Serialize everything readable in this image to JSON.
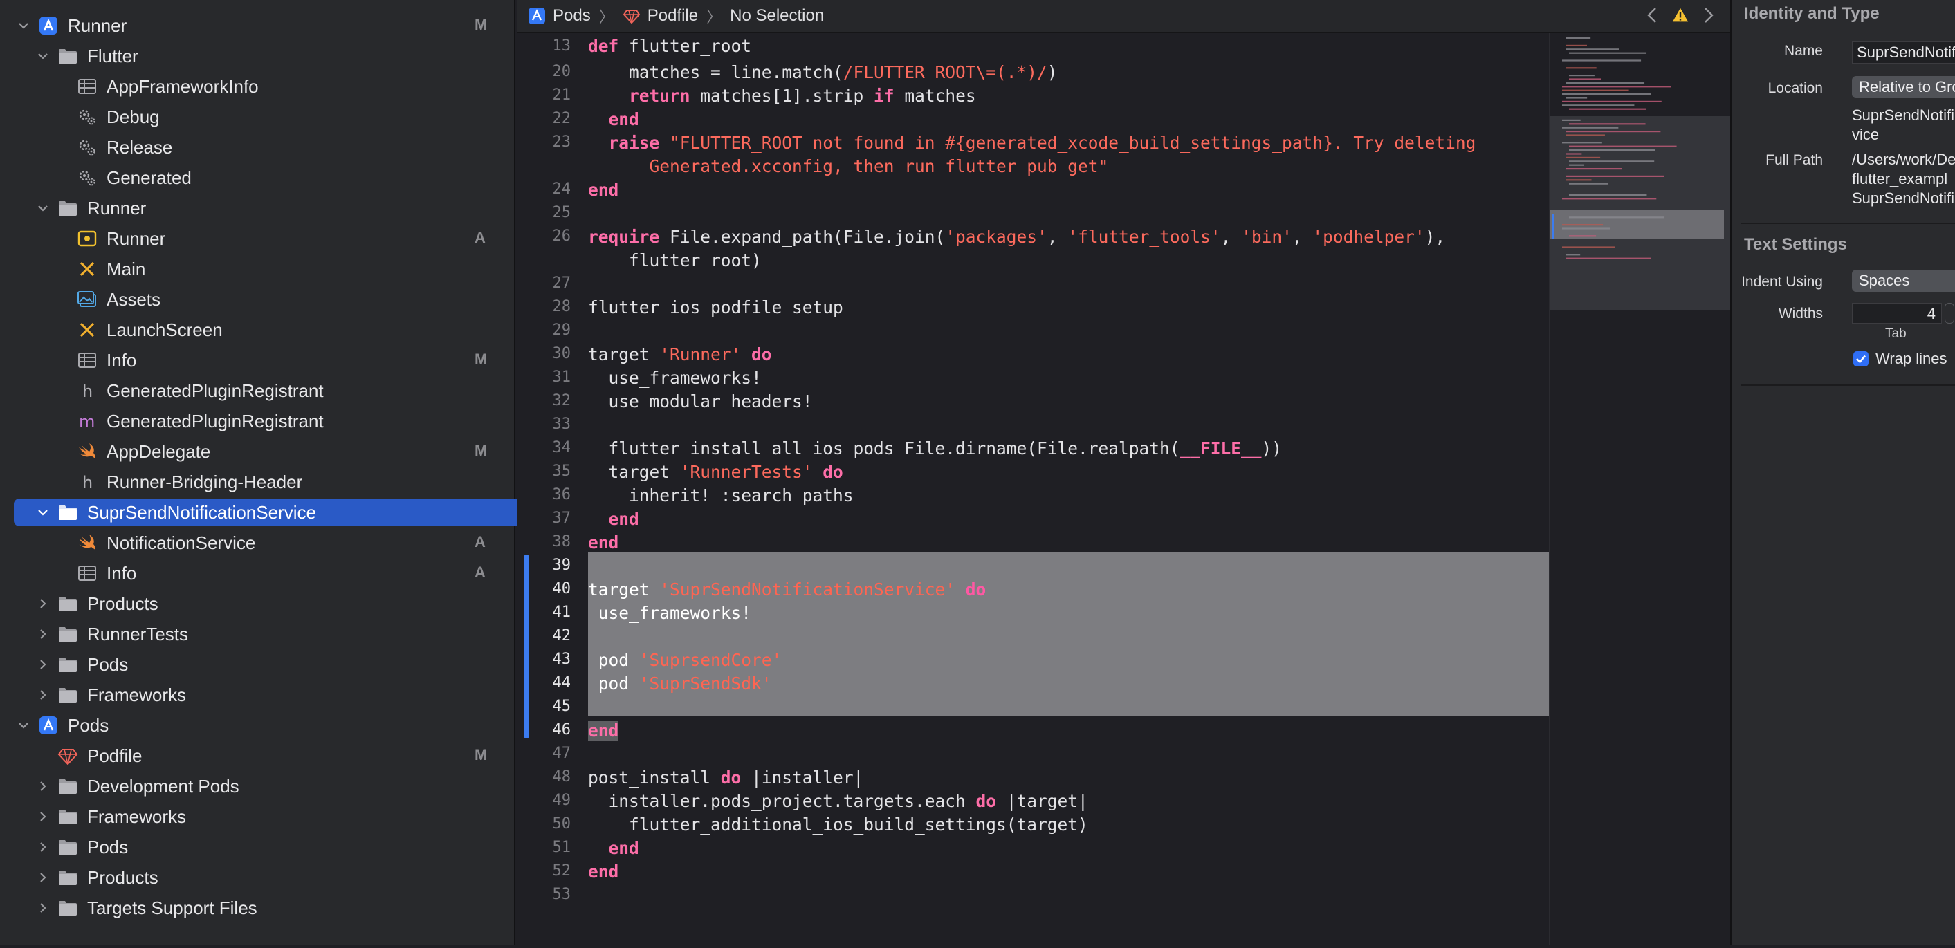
{
  "navigator": {
    "rows": [
      {
        "label": "Runner",
        "badge": "M"
      },
      {
        "label": "Flutter",
        "badge": ""
      },
      {
        "label": "AppFrameworkInfo",
        "badge": ""
      },
      {
        "label": "Debug",
        "badge": ""
      },
      {
        "label": "Release",
        "badge": ""
      },
      {
        "label": "Generated",
        "badge": ""
      },
      {
        "label": "Runner",
        "badge": ""
      },
      {
        "label": "Runner",
        "badge": "A"
      },
      {
        "label": "Main",
        "badge": ""
      },
      {
        "label": "Assets",
        "badge": ""
      },
      {
        "label": "LaunchScreen",
        "badge": ""
      },
      {
        "label": "Info",
        "badge": "M"
      },
      {
        "label": "GeneratedPluginRegistrant",
        "badge": ""
      },
      {
        "label": "GeneratedPluginRegistrant",
        "badge": ""
      },
      {
        "label": "AppDelegate",
        "badge": "M"
      },
      {
        "label": "Runner-Bridging-Header",
        "badge": ""
      },
      {
        "label": "SuprSendNotificationService",
        "badge": ""
      },
      {
        "label": "NotificationService",
        "badge": "A"
      },
      {
        "label": "Info",
        "badge": "A"
      },
      {
        "label": "Products",
        "badge": ""
      },
      {
        "label": "RunnerTests",
        "badge": ""
      },
      {
        "label": "Pods",
        "badge": ""
      },
      {
        "label": "Frameworks",
        "badge": ""
      },
      {
        "label": "Pods",
        "badge": ""
      },
      {
        "label": "Podfile",
        "badge": "M"
      },
      {
        "label": "Development Pods",
        "badge": ""
      },
      {
        "label": "Frameworks",
        "badge": ""
      },
      {
        "label": "Pods",
        "badge": ""
      },
      {
        "label": "Products",
        "badge": ""
      },
      {
        "label": "Targets Support Files",
        "badge": ""
      }
    ]
  },
  "jumpbar": {
    "crumbs": [
      "Pods",
      "Podfile",
      "No Selection"
    ]
  },
  "editor": {
    "sticky": {
      "num": "13",
      "code": [
        [
          "kw",
          "def"
        ],
        [
          "pl",
          " flutter_root"
        ]
      ]
    },
    "lines": [
      {
        "num": "20",
        "code": [
          [
            "pl",
            "    matches = line.match("
          ],
          [
            "str",
            "/FLUTTER_ROOT\\=(.*)/"
          ],
          [
            "pl",
            ")"
          ]
        ]
      },
      {
        "num": "21",
        "code": [
          [
            "pl",
            "    "
          ],
          [
            "kw",
            "return"
          ],
          [
            "pl",
            " matches[1].strip "
          ],
          [
            "kw",
            "if"
          ],
          [
            "pl",
            " matches"
          ]
        ]
      },
      {
        "num": "22",
        "code": [
          [
            "pl",
            "  "
          ],
          [
            "kw",
            "end"
          ]
        ]
      },
      {
        "num": "23",
        "code": [
          [
            "pl",
            "  "
          ],
          [
            "kw",
            "raise"
          ],
          [
            "pl",
            " "
          ],
          [
            "str",
            "\"FLUTTER_ROOT not found in #{generated_xcode_build_settings_path}. Try deleting"
          ]
        ]
      },
      {
        "num": "",
        "code": [
          [
            "str",
            "      Generated.xcconfig, then run flutter pub get\""
          ]
        ]
      },
      {
        "num": "24",
        "code": [
          [
            "kw",
            "end"
          ]
        ]
      },
      {
        "num": "25",
        "code": []
      },
      {
        "num": "26",
        "code": [
          [
            "kw",
            "require"
          ],
          [
            "pl",
            " File.expand_path(File.join("
          ],
          [
            "str",
            "'packages'"
          ],
          [
            "pl",
            ", "
          ],
          [
            "str",
            "'flutter_tools'"
          ],
          [
            "pl",
            ", "
          ],
          [
            "str",
            "'bin'"
          ],
          [
            "pl",
            ", "
          ],
          [
            "str",
            "'podhelper'"
          ],
          [
            "pl",
            "),"
          ]
        ]
      },
      {
        "num": "",
        "code": [
          [
            "pl",
            "    flutter_root)"
          ]
        ]
      },
      {
        "num": "27",
        "code": []
      },
      {
        "num": "28",
        "code": [
          [
            "pl",
            "flutter_ios_podfile_setup"
          ]
        ]
      },
      {
        "num": "29",
        "code": []
      },
      {
        "num": "30",
        "code": [
          [
            "pl",
            "target "
          ],
          [
            "str",
            "'Runner'"
          ],
          [
            "pl",
            " "
          ],
          [
            "kw",
            "do"
          ]
        ]
      },
      {
        "num": "31",
        "code": [
          [
            "pl",
            "  use_frameworks!"
          ]
        ]
      },
      {
        "num": "32",
        "code": [
          [
            "pl",
            "  use_modular_headers!"
          ]
        ]
      },
      {
        "num": "33",
        "code": []
      },
      {
        "num": "34",
        "code": [
          [
            "pl",
            "  flutter_install_all_ios_pods File.dirname(File.realpath("
          ],
          [
            "kw",
            "__FILE__"
          ],
          [
            "pl",
            "))"
          ]
        ]
      },
      {
        "num": "35",
        "code": [
          [
            "pl",
            "  target "
          ],
          [
            "str",
            "'RunnerTests'"
          ],
          [
            "pl",
            " "
          ],
          [
            "kw",
            "do"
          ]
        ]
      },
      {
        "num": "36",
        "code": [
          [
            "pl",
            "    inherit! :search_paths"
          ]
        ]
      },
      {
        "num": "37",
        "code": [
          [
            "pl",
            "  "
          ],
          [
            "kw",
            "end"
          ]
        ]
      },
      {
        "num": "38",
        "code": [
          [
            "kw",
            "end"
          ]
        ]
      },
      {
        "num": "39",
        "code": []
      },
      {
        "num": "40",
        "code": [
          [
            "pl",
            "target "
          ],
          [
            "str",
            "'SuprSendNotificationService'"
          ],
          [
            "pl",
            " "
          ],
          [
            "kw",
            "do"
          ]
        ]
      },
      {
        "num": "41",
        "code": [
          [
            "pl",
            " use_frameworks!"
          ]
        ]
      },
      {
        "num": "42",
        "code": []
      },
      {
        "num": "43",
        "code": [
          [
            "pl",
            " pod "
          ],
          [
            "str",
            "'SuprsendCore'"
          ]
        ]
      },
      {
        "num": "44",
        "code": [
          [
            "pl",
            " pod "
          ],
          [
            "str",
            "'SuprSendSdk'"
          ]
        ]
      },
      {
        "num": "45",
        "code": []
      },
      {
        "num": "46",
        "code": [
          [
            "kw",
            "end"
          ]
        ]
      },
      {
        "num": "47",
        "code": []
      },
      {
        "num": "48",
        "code": [
          [
            "pl",
            "post_install "
          ],
          [
            "kw",
            "do"
          ],
          [
            "pl",
            " |installer|"
          ]
        ]
      },
      {
        "num": "49",
        "code": [
          [
            "pl",
            "  installer.pods_project.targets.each "
          ],
          [
            "kw",
            "do"
          ],
          [
            "pl",
            " |target|"
          ]
        ]
      },
      {
        "num": "50",
        "code": [
          [
            "pl",
            "    flutter_additional_ios_build_settings(target)"
          ]
        ]
      },
      {
        "num": "51",
        "code": [
          [
            "pl",
            "  "
          ],
          [
            "kw",
            "end"
          ]
        ]
      },
      {
        "num": "52",
        "code": [
          [
            "kw",
            "end"
          ]
        ]
      },
      {
        "num": "53",
        "code": []
      }
    ]
  },
  "inspector": {
    "identity_heading": "Identity and Type",
    "name_label": "Name",
    "name_value": "SuprSendNotificationService",
    "location_label": "Location",
    "location_value": "Relative to Group",
    "location_path_1": "SuprSendNotifi",
    "location_path_2": "vice",
    "fullpath_label": "Full Path",
    "fullpath_1": "/Users/work/De",
    "fullpath_2": "flutter_exampl",
    "fullpath_3": "SuprSendNotifi",
    "text_heading": "Text Settings",
    "indent_label": "Indent Using",
    "indent_value": "Spaces",
    "widths_label": "Widths",
    "widths_value": "4",
    "tab_label": "Tab",
    "wrap_label": "Wrap lines",
    "colors": {
      "accent": "#2a5ac6",
      "folder": "#b8b8bc",
      "project": "#3478f6"
    }
  }
}
